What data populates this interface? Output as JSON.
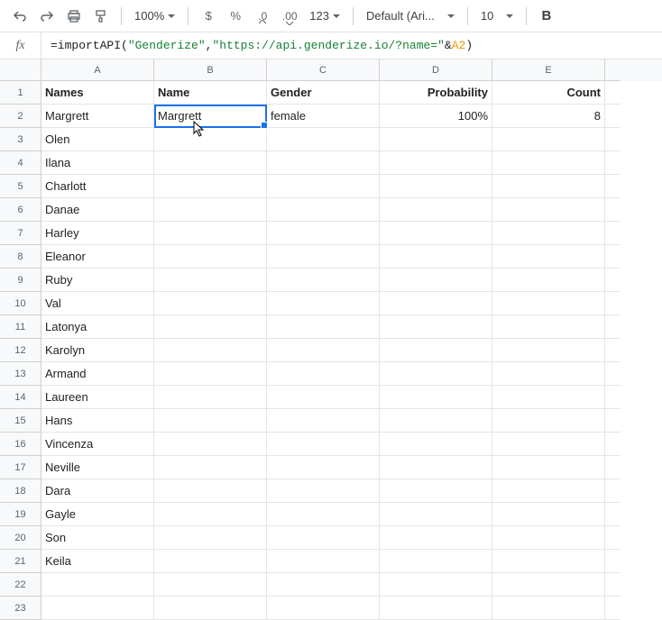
{
  "toolbar": {
    "zoom": "100%",
    "currency": "$",
    "percent": "%",
    "dec_minus": ".0",
    "dec_plus": ".00",
    "more_formats": "123",
    "font": "Default (Ari...",
    "font_size": "10",
    "bold": "B"
  },
  "formula": {
    "prefix": "=importAPI(",
    "str1": "\"Genderize\"",
    "comma": ",",
    "str2": "\"https://api.genderize.io/?name=\"",
    "amp": "&",
    "ref": "A2",
    "suffix": ")"
  },
  "columns": [
    "A",
    "B",
    "C",
    "D",
    "E"
  ],
  "headers": {
    "A": "Names",
    "B": "Name",
    "C": "Gender",
    "D": "Probability",
    "E": "Count"
  },
  "rows": [
    {
      "n": "1",
      "A": "Names",
      "B": "Name",
      "C": "Gender",
      "D": "Probability",
      "E": "Count",
      "hdr": true
    },
    {
      "n": "2",
      "A": "Margrett",
      "B": "Margrett",
      "C": "female",
      "D": "100%",
      "E": "8"
    },
    {
      "n": "3",
      "A": "Olen"
    },
    {
      "n": "4",
      "A": "Ilana"
    },
    {
      "n": "5",
      "A": "Charlott"
    },
    {
      "n": "6",
      "A": "Danae"
    },
    {
      "n": "7",
      "A": "Harley"
    },
    {
      "n": "8",
      "A": "Eleanor"
    },
    {
      "n": "9",
      "A": "Ruby"
    },
    {
      "n": "10",
      "A": "Val"
    },
    {
      "n": "11",
      "A": "Latonya"
    },
    {
      "n": "12",
      "A": "Karolyn"
    },
    {
      "n": "13",
      "A": "Armand"
    },
    {
      "n": "14",
      "A": "Laureen"
    },
    {
      "n": "15",
      "A": "Hans"
    },
    {
      "n": "16",
      "A": "Vincenza"
    },
    {
      "n": "17",
      "A": "Neville"
    },
    {
      "n": "18",
      "A": "Dara"
    },
    {
      "n": "19",
      "A": "Gayle"
    },
    {
      "n": "20",
      "A": "Son"
    },
    {
      "n": "21",
      "A": "Keila"
    },
    {
      "n": "22"
    },
    {
      "n": "23"
    }
  ]
}
